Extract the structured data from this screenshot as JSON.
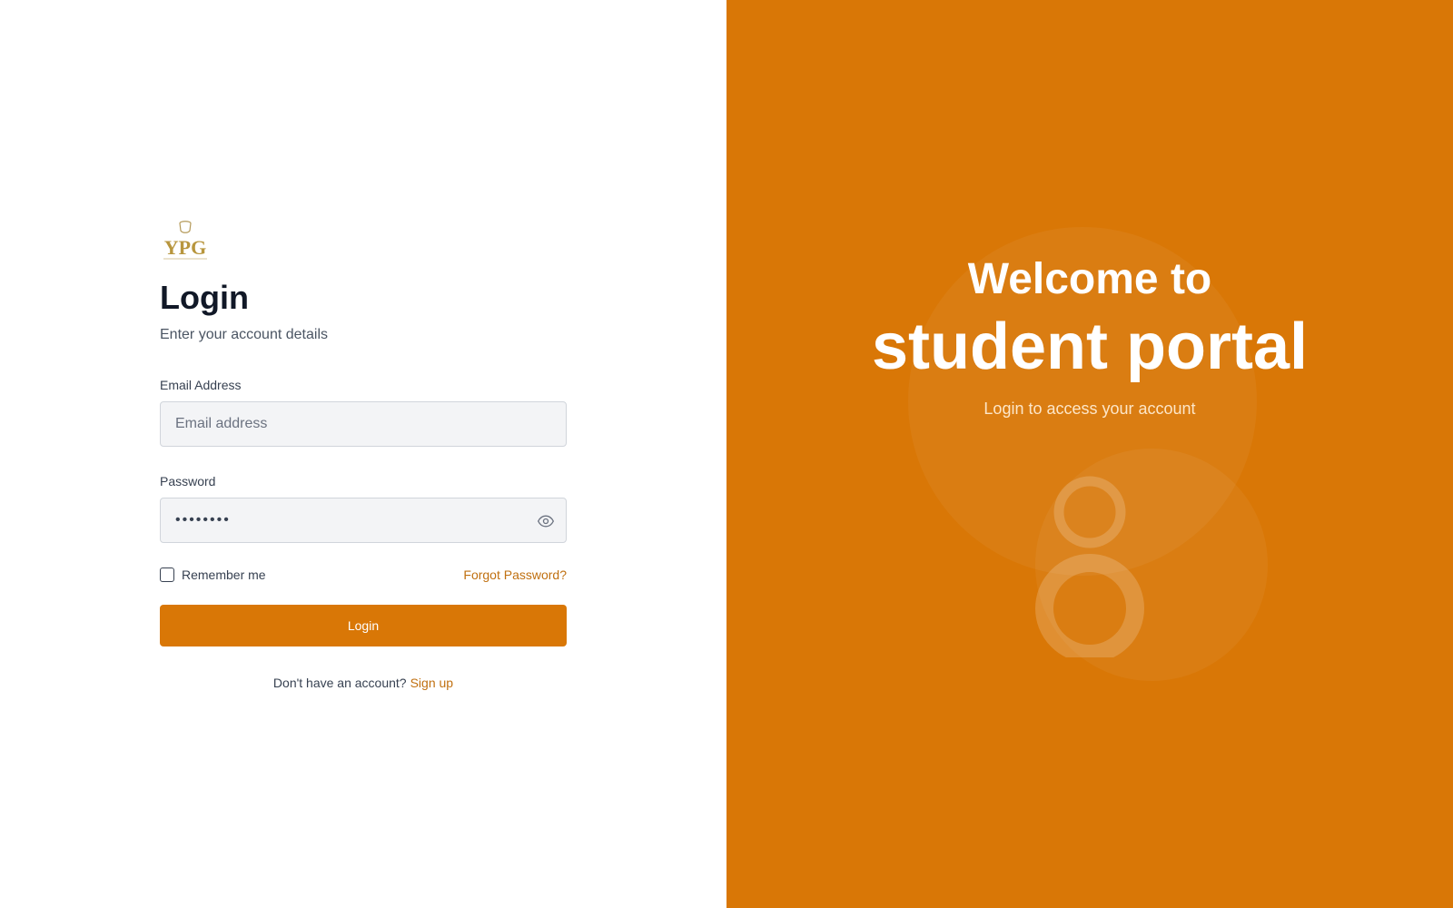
{
  "brand": {
    "logo_text": "YPG",
    "accent": "#d97706",
    "link_color": "#c07010"
  },
  "login": {
    "title": "Login",
    "subtitle": "Enter your account details",
    "email_label": "Email Address",
    "email_placeholder": "Email address",
    "email_value": "",
    "password_label": "Password",
    "password_value": "••••••••",
    "password_toggle_icon": "eye-icon",
    "remember_label": "Remember me",
    "remember_checked": false,
    "forgot_label": "Forgot Password?",
    "submit_label": "Login",
    "signup_prompt": "Don't have an account?",
    "signup_label": "Sign up"
  },
  "hero": {
    "welcome": "Welcome to",
    "portal": "student portal",
    "subtitle": "Login to access your account",
    "illustration_icon": "user-silhouette-icon"
  }
}
